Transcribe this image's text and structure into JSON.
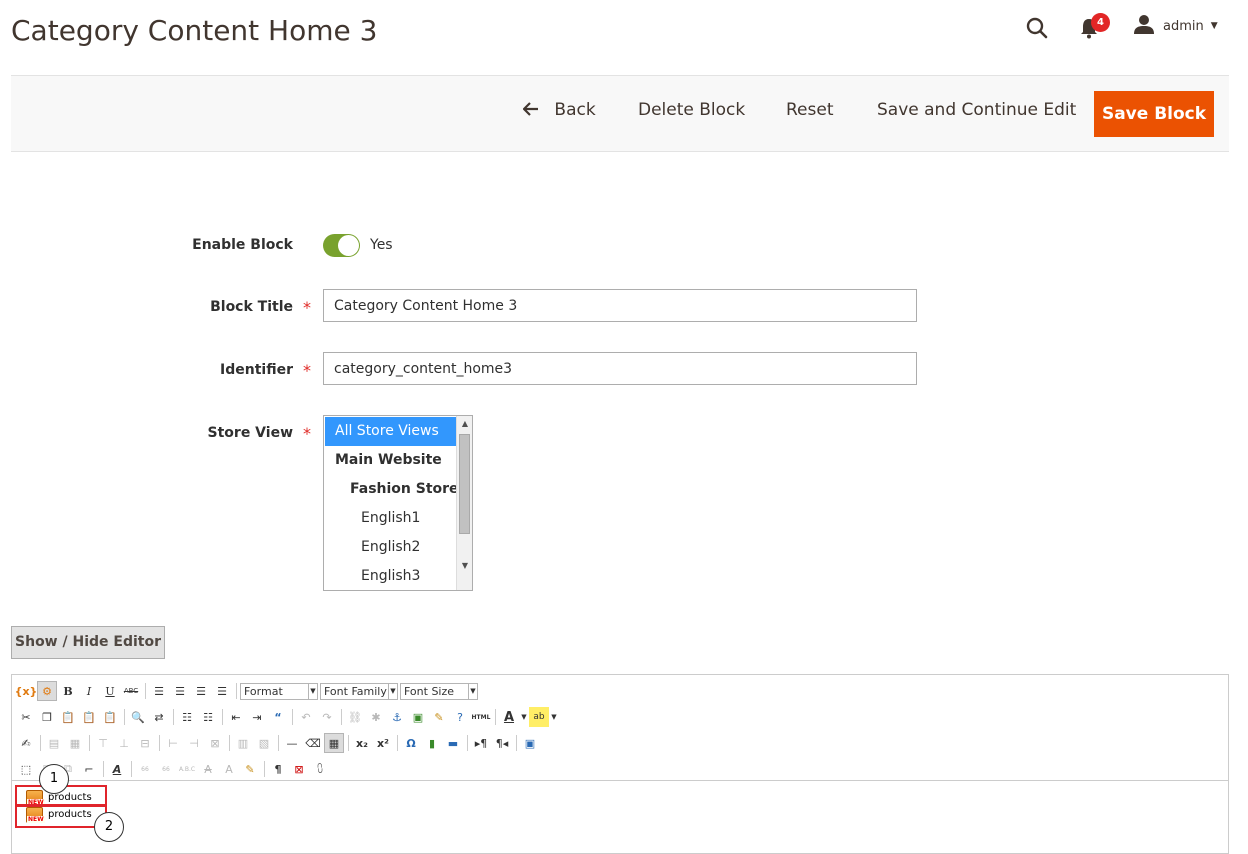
{
  "header": {
    "title": "Category Content Home 3",
    "notifications_count": "4",
    "user_name": "admin"
  },
  "actions": {
    "back": "Back",
    "delete": "Delete Block",
    "reset": "Reset",
    "save_continue": "Save and Continue Edit",
    "save": "Save Block"
  },
  "form": {
    "enable_label": "Enable Block",
    "enable_value": "Yes",
    "enabled": true,
    "title_label": "Block Title",
    "title_value": "Category Content Home 3",
    "identifier_label": "Identifier",
    "identifier_value": "category_content_home3",
    "store_view_label": "Store View",
    "store_view_options": [
      {
        "label": "All Store Views",
        "selected": true
      },
      {
        "label": "Main Website",
        "selected": false
      },
      {
        "label": "Fashion Store",
        "selected": false
      },
      {
        "label": "English1",
        "selected": false
      },
      {
        "label": "English2",
        "selected": false
      },
      {
        "label": "English3",
        "selected": false
      }
    ]
  },
  "editor": {
    "toggle_label": "Show / Hide Editor",
    "format_select": "Format",
    "font_family_select": "Font Family",
    "font_size_select": "Font Size",
    "html_button": "HTML",
    "widgets": [
      {
        "label": "products",
        "icon_text": "NEW"
      },
      {
        "label": "products",
        "icon_text": "NEW"
      }
    ],
    "callouts": [
      "1",
      "2"
    ]
  },
  "colors": {
    "accent": "#eb5202",
    "toggle_on": "#79a22e",
    "selected_option": "#3297fd",
    "required": "#e02b27",
    "badge": "#e22626",
    "highlight_box": "#e0242b"
  }
}
